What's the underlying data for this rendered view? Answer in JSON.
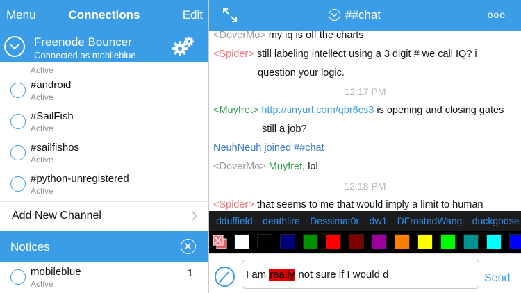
{
  "left_nav": {
    "menu_label": "Menu",
    "title": "Connections",
    "edit_label": "Edit"
  },
  "server": {
    "name": "Freenode Bouncer",
    "status": "Connected as mobileblue",
    "settings_icon": "gear-icon"
  },
  "channels": [
    {
      "name": "#android",
      "status": "Active"
    },
    {
      "name": "#SailFish",
      "status": "Active"
    },
    {
      "name": "#sailfishos",
      "status": "Active"
    },
    {
      "name": "#python-unregistered",
      "status": "Active"
    }
  ],
  "partial_channel_status": "Active",
  "add_channel_label": "Add New Channel",
  "notices": {
    "label": "Notices"
  },
  "queries": [
    {
      "name": "mobileblue",
      "status": "Active",
      "count": "1"
    }
  ],
  "chat": {
    "title": "##chat",
    "more_label": "ooo",
    "messages": [
      {
        "nick": "<DoverMo>",
        "text": "my iq is off the charts"
      },
      {
        "nick": "<Spider>",
        "text": "still labeling intellect using a 3 digit # we call IQ? i"
      },
      {
        "continuation": "question your logic."
      },
      {
        "timestamp": "12:17 PM"
      },
      {
        "nick": "<Muyfret>",
        "link": "http://tinyurl.com/qbr6cs3",
        "text": "is opening and closing gates"
      },
      {
        "continuation": "still a job?"
      },
      {
        "system": "NeuhNeuh joined ##chat"
      },
      {
        "nick": "<DoverMo>",
        "mention": "Muyfret",
        "text": ", lol"
      },
      {
        "timestamp2": "12:18 PM"
      },
      {
        "nick": "<Spider>",
        "text": "that seems to me that would imply a limit to human"
      }
    ]
  },
  "userbar": [
    "dduffield",
    "deathlire",
    "Dessimat0r",
    "dw1",
    "DFrostedWang",
    "duckgoose"
  ],
  "colors": [
    "#ffffff",
    "#000000",
    "#00007f",
    "#009300",
    "#ff0000",
    "#7f0000",
    "#9c009c",
    "#fc7f00",
    "#ffff00",
    "#00fc00",
    "#009393",
    "#00ffff",
    "#0000fc"
  ],
  "input": {
    "before": "I am ",
    "highlight": "really",
    "after": " not sure if I would d",
    "send_label": "Send"
  }
}
